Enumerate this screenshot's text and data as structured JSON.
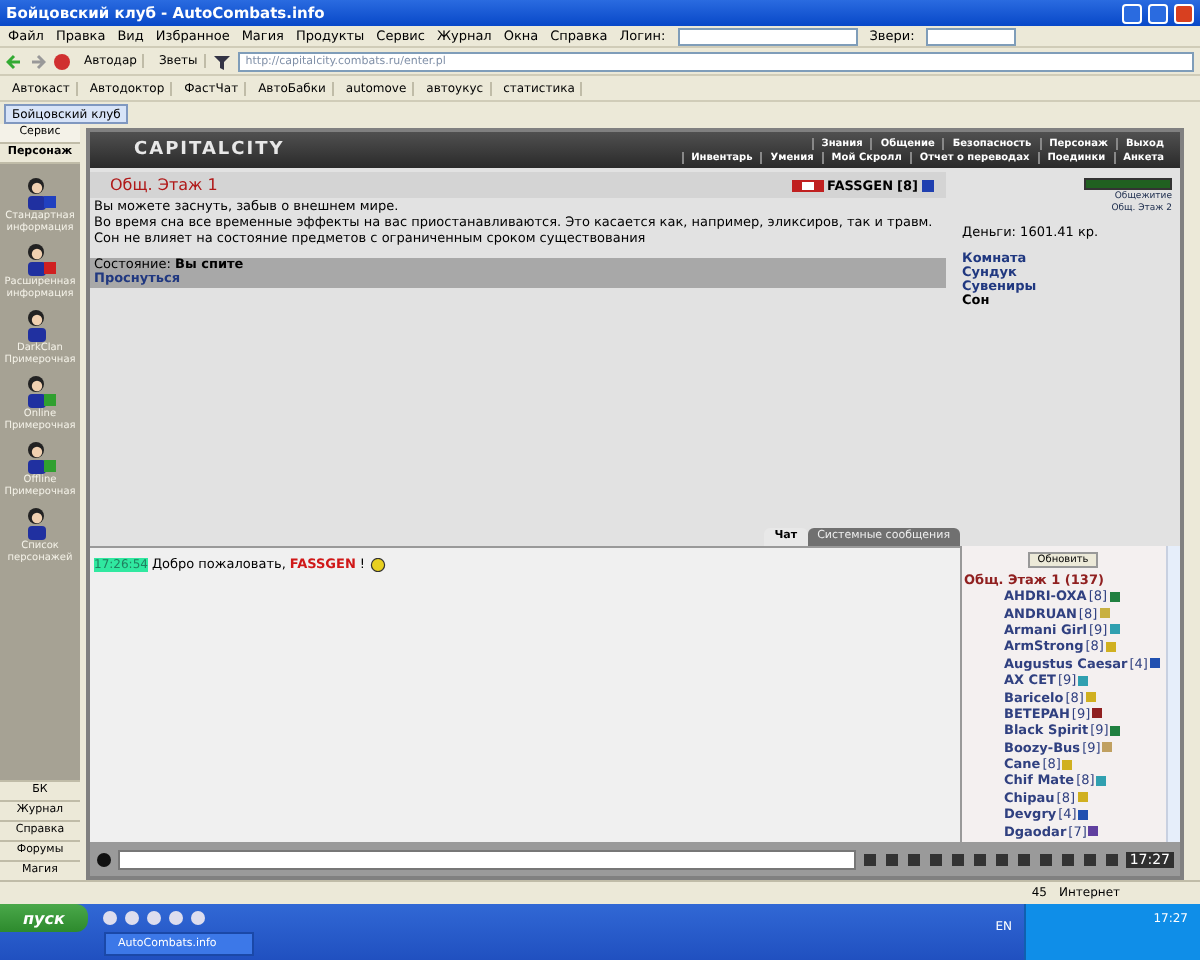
{
  "window": {
    "title": "Бойцовский клуб - AutoCombats.info"
  },
  "menu": [
    "Файл",
    "Правка",
    "Вид",
    "Избранное",
    "Магия",
    "Продукты",
    "Сервис",
    "Журнал",
    "Окна",
    "Справка"
  ],
  "toolbar": {
    "login_label": "Логин:",
    "beasts_label": "Звери:",
    "dropdowns": [
      "Автодар",
      "Зветы"
    ],
    "address": "http://capitalcity.combats.ru/enter.pl"
  },
  "links": [
    "Автокаст",
    "Автодоктор",
    "ФастЧат",
    "АвтоБабки",
    "automove",
    "автоукус",
    "статистика"
  ],
  "doc_tab": "Бойцовский клуб",
  "sidebar": {
    "tabs": [
      {
        "label": "Сервис",
        "selected": false
      },
      {
        "label": "Персонаж",
        "selected": true
      }
    ],
    "items": [
      {
        "label": "Стандартная информация",
        "color": "#2040c0"
      },
      {
        "label": "Расширенная информация",
        "color": "#d02020"
      },
      {
        "label": "DarkClan Примерочная"
      },
      {
        "label": "Online Примерочная",
        "color": "#30a030"
      },
      {
        "label": "Offline Примерочная",
        "color": "#30a030"
      },
      {
        "label": "Список персонажей"
      }
    ],
    "bottom": [
      "БК",
      "Журнал",
      "Справка",
      "Форумы",
      "Магия"
    ]
  },
  "game": {
    "logo": "CAPITALCITY",
    "nav_top": [
      "Знания",
      "Общение",
      "Безопасность",
      "Персонаж",
      "Выход"
    ],
    "nav_bottom": [
      "Инвентарь",
      "Умения",
      "Мой Скролл",
      "Отчет о переводах",
      "Поединки",
      "Анкета"
    ],
    "location": "Общ. Этаж 1",
    "player": "FASSGEN",
    "player_level": "[8]",
    "lines": [
      "Вы можете заснуть, забыв о внешнем мире.",
      "Во время сна все временные эффекты на вас приостанавливаются. Это касается как, например, эликсиров, так и травм.",
      "Сон не влияет на состояние предметов с ограниченным сроком существования"
    ],
    "state_label": "Состояние:",
    "state_value": "Вы спите",
    "wake": "Проснуться",
    "money": "Деньги: 1601.41 кр.",
    "map_links": [
      "Общежитие",
      "Общ. Этаж 2"
    ],
    "rooms": [
      {
        "label": "Комната",
        "selected": false
      },
      {
        "label": "Сундук",
        "selected": false
      },
      {
        "label": "Сувениры",
        "selected": false
      },
      {
        "label": "Сон",
        "selected": true
      }
    ]
  },
  "chat": {
    "tabs": [
      {
        "label": "Чат",
        "selected": true
      },
      {
        "label": "Системные сообщения",
        "selected": false
      }
    ],
    "messages": [
      {
        "time": "17:26:54",
        "text": "Добро пожаловать,",
        "name": "FASSGEN",
        "end": "!"
      }
    ],
    "clock": "17:27"
  },
  "online": {
    "refresh": "Обновить",
    "room": "Общ. Этаж 1 (137)",
    "users": [
      {
        "name": "AHDRI-OXA",
        "level": "[8]",
        "color": "#208040"
      },
      {
        "name": "ANDRUAN",
        "level": "[8]",
        "color": "#c8b040"
      },
      {
        "name": "Armani Girl",
        "level": "[9]",
        "color": "#30a0b0"
      },
      {
        "name": "ArmStrong",
        "level": "[8]",
        "color": "#d0b020"
      },
      {
        "name": "Augustus Caesar",
        "level": "[4]",
        "color": "#2050b0"
      },
      {
        "name": "AX CET",
        "level": "[9]",
        "color": "#30a0b0"
      },
      {
        "name": "Baricelo",
        "level": "[8]",
        "color": "#d0b020"
      },
      {
        "name": "BETEPAH",
        "level": "[9]",
        "color": "#902020"
      },
      {
        "name": "Black Spirit",
        "level": "[9]",
        "color": "#208040"
      },
      {
        "name": "Boozy-Bus",
        "level": "[9]",
        "color": "#c0a060"
      },
      {
        "name": "Cane",
        "level": "[8]",
        "color": "#d0b020"
      },
      {
        "name": "Chif Mate",
        "level": "[8]",
        "color": "#30a0b0"
      },
      {
        "name": "Chipau",
        "level": "[8]",
        "color": "#d0b020"
      },
      {
        "name": "Devgry",
        "level": "[4]",
        "color": "#2050b0"
      },
      {
        "name": "Dgaodar",
        "level": "[7]",
        "color": "#6040a0"
      }
    ]
  },
  "status_bar": {
    "count": "45",
    "zone": "Интернет"
  },
  "taskbar": {
    "start": "пуск",
    "task": "AutoCombats.info",
    "lang": "EN",
    "clock": "17:27"
  }
}
